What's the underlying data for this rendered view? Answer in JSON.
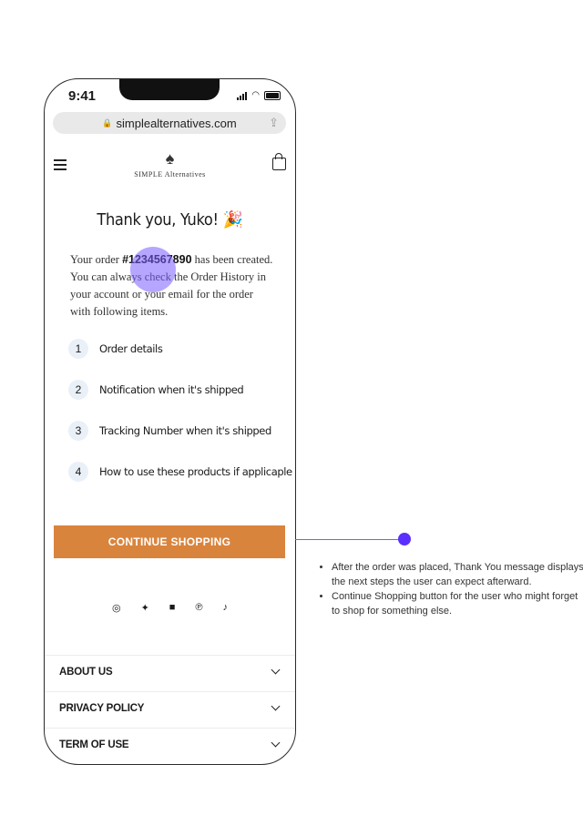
{
  "status": {
    "time": "9:41"
  },
  "browser": {
    "url": "simplealternatives.com"
  },
  "header": {
    "logo_text": "SIMPLE Alternatives",
    "logo_mark": "ᐯᐯᐯ"
  },
  "thanks": {
    "title": "Thank you, Yuko! 🎉"
  },
  "order": {
    "prefix": "Your order ",
    "number": "#1234567890",
    "suffix": " has been created. You can always check the Order History in your account or your email for the order with following items."
  },
  "steps": [
    {
      "num": "1",
      "label": "Order details"
    },
    {
      "num": "2",
      "label": "Notification when it's shipped"
    },
    {
      "num": "3",
      "label": "Tracking Number when it's shipped"
    },
    {
      "num": "4",
      "label": "How to use these products if applicaple"
    }
  ],
  "cta": {
    "label": "CONTINUE SHOPPING"
  },
  "social": [
    "instagram-icon",
    "twitter-icon",
    "facebook-icon",
    "pinterest-icon",
    "tiktok-icon"
  ],
  "footer": [
    {
      "label": "ABOUT US"
    },
    {
      "label": "PRIVACY POLICY"
    },
    {
      "label": "TERM OF USE"
    }
  ],
  "notes": [
    "After the order was placed, Thank You message displays the next steps the user can expect afterward.",
    "Continue Shopping button for the user who might forget to shop for something else."
  ],
  "colors": {
    "accent": "#d9843d",
    "annotation": "#5a2fff"
  }
}
